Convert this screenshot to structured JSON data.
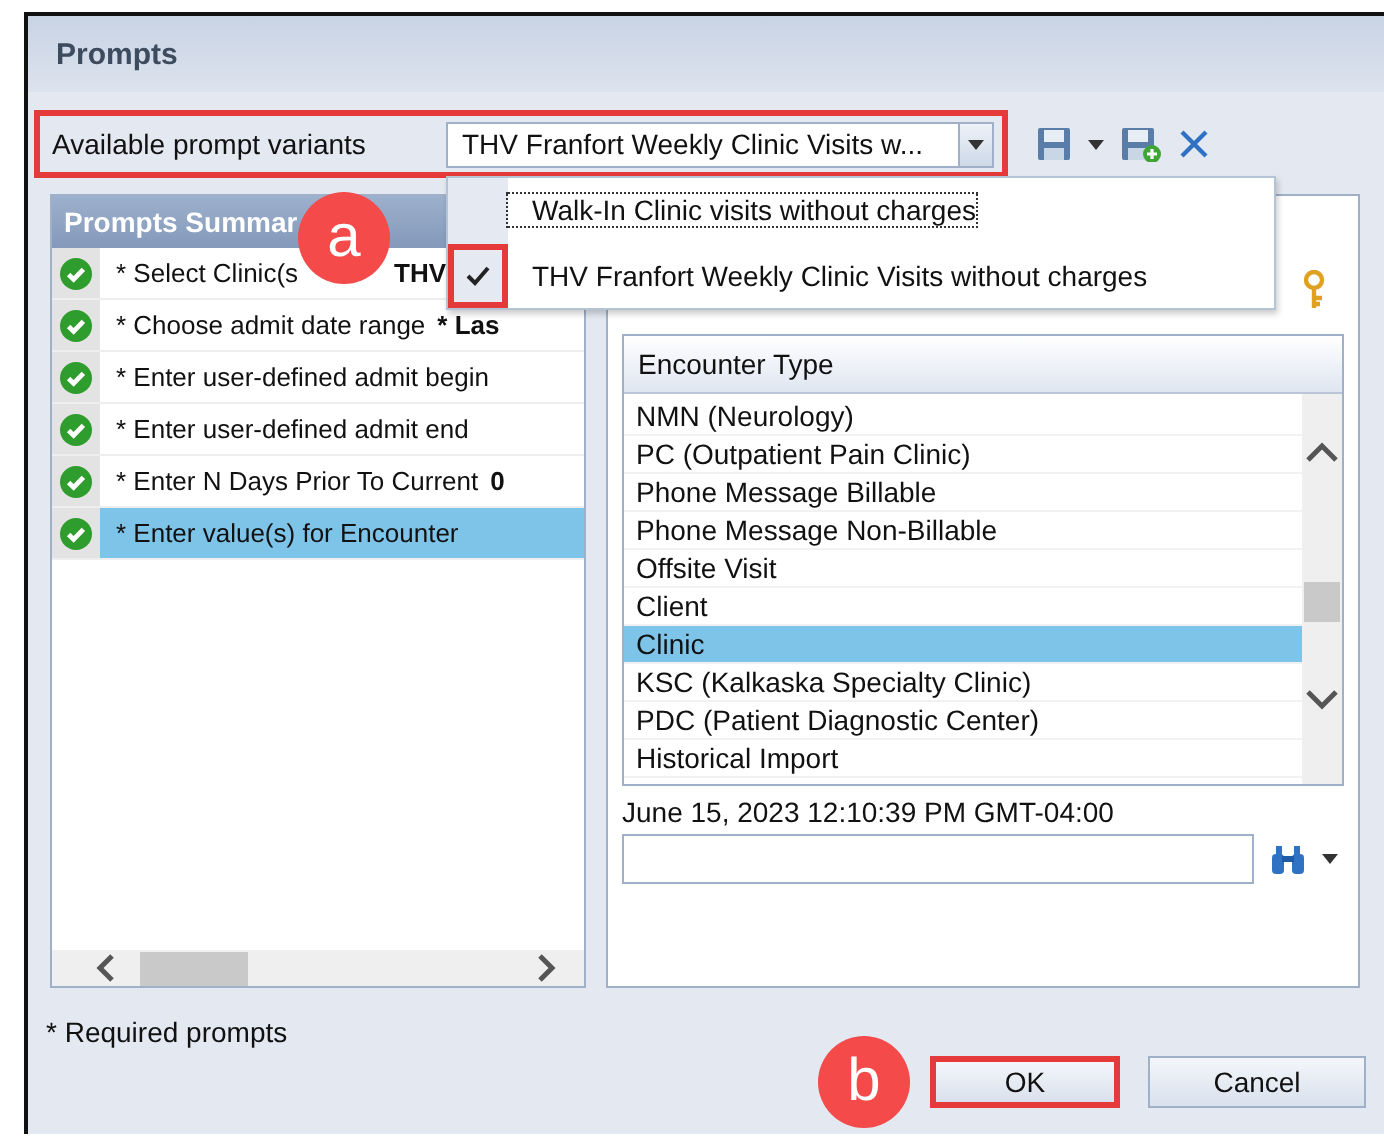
{
  "window": {
    "title": "Prompts"
  },
  "variants": {
    "label": "Available prompt variants",
    "value": "THV Franfort Weekly Clinic Visits w...",
    "highlighted": true,
    "menu": [
      {
        "label": "Walk-In Clinic visits without charges",
        "selected": false,
        "highlighted": false
      },
      {
        "label": "THV Franfort Weekly Clinic Visits without charges",
        "selected": true,
        "highlighted": true
      }
    ]
  },
  "summary": {
    "title": "Prompts Summar",
    "rows": [
      {
        "label": "* Select Clinic(s",
        "value": "THV",
        "complete": true,
        "selected": false
      },
      {
        "label": "* Choose admit date range",
        "value": "* Las",
        "complete": true,
        "selected": false
      },
      {
        "label": "* Enter user-defined admit begin",
        "value": "",
        "complete": true,
        "selected": false
      },
      {
        "label": "* Enter user-defined admit end",
        "value": "",
        "complete": true,
        "selected": false
      },
      {
        "label": "* Enter N Days Prior To Current",
        "value": "0",
        "complete": true,
        "selected": false
      },
      {
        "label": "* Enter value(s) for Encounter",
        "value": "",
        "complete": true,
        "selected": true
      }
    ]
  },
  "encounter": {
    "header": "Encounter Type",
    "items": [
      {
        "label": "NMN (Neurology)",
        "selected": false
      },
      {
        "label": "PC (Outpatient Pain Clinic)",
        "selected": false
      },
      {
        "label": "Phone Message Billable",
        "selected": false
      },
      {
        "label": "Phone Message Non-Billable",
        "selected": false
      },
      {
        "label": "Offsite Visit",
        "selected": false
      },
      {
        "label": "Client",
        "selected": false
      },
      {
        "label": "Clinic",
        "selected": true
      },
      {
        "label": "KSC (Kalkaska Specialty Clinic)",
        "selected": false
      },
      {
        "label": "PDC (Patient Diagnostic Center)",
        "selected": false
      },
      {
        "label": "Historical Import",
        "selected": false
      }
    ],
    "timestamp": "June 15, 2023 12:10:39 PM GMT-04:00"
  },
  "footnote": "* Required prompts",
  "buttons": [
    {
      "label": "OK",
      "highlighted": true
    },
    {
      "label": "Cancel",
      "highlighted": false
    }
  ],
  "callouts": [
    {
      "label": "a"
    },
    {
      "label": "b"
    }
  ]
}
